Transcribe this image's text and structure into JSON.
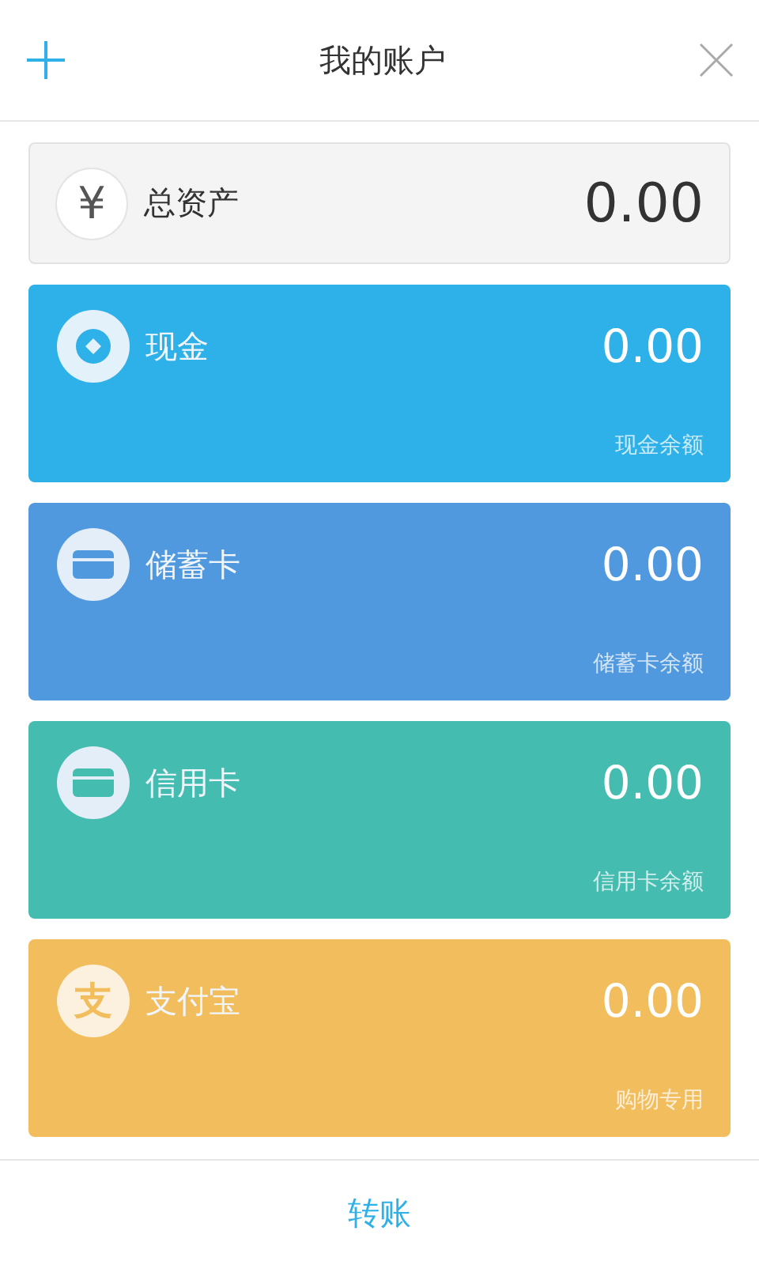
{
  "header": {
    "title": "我的账户"
  },
  "total": {
    "symbol": "¥",
    "label": "总资产",
    "amount": "0.00"
  },
  "accounts": [
    {
      "kind": "coin",
      "name": "现金",
      "amount": "0.00",
      "caption": "现金余额",
      "color": "#2eb0e8"
    },
    {
      "kind": "card",
      "name": "储蓄卡",
      "amount": "0.00",
      "caption": "储蓄卡余额",
      "color": "#5199de"
    },
    {
      "kind": "card",
      "name": "信用卡",
      "amount": "0.00",
      "caption": "信用卡余额",
      "color": "#45bcb0"
    },
    {
      "kind": "char",
      "icon_text": "支",
      "name": "支付宝",
      "amount": "0.00",
      "caption": "购物专用",
      "color": "#f2bd5c"
    }
  ],
  "footer": {
    "action": "转账"
  }
}
